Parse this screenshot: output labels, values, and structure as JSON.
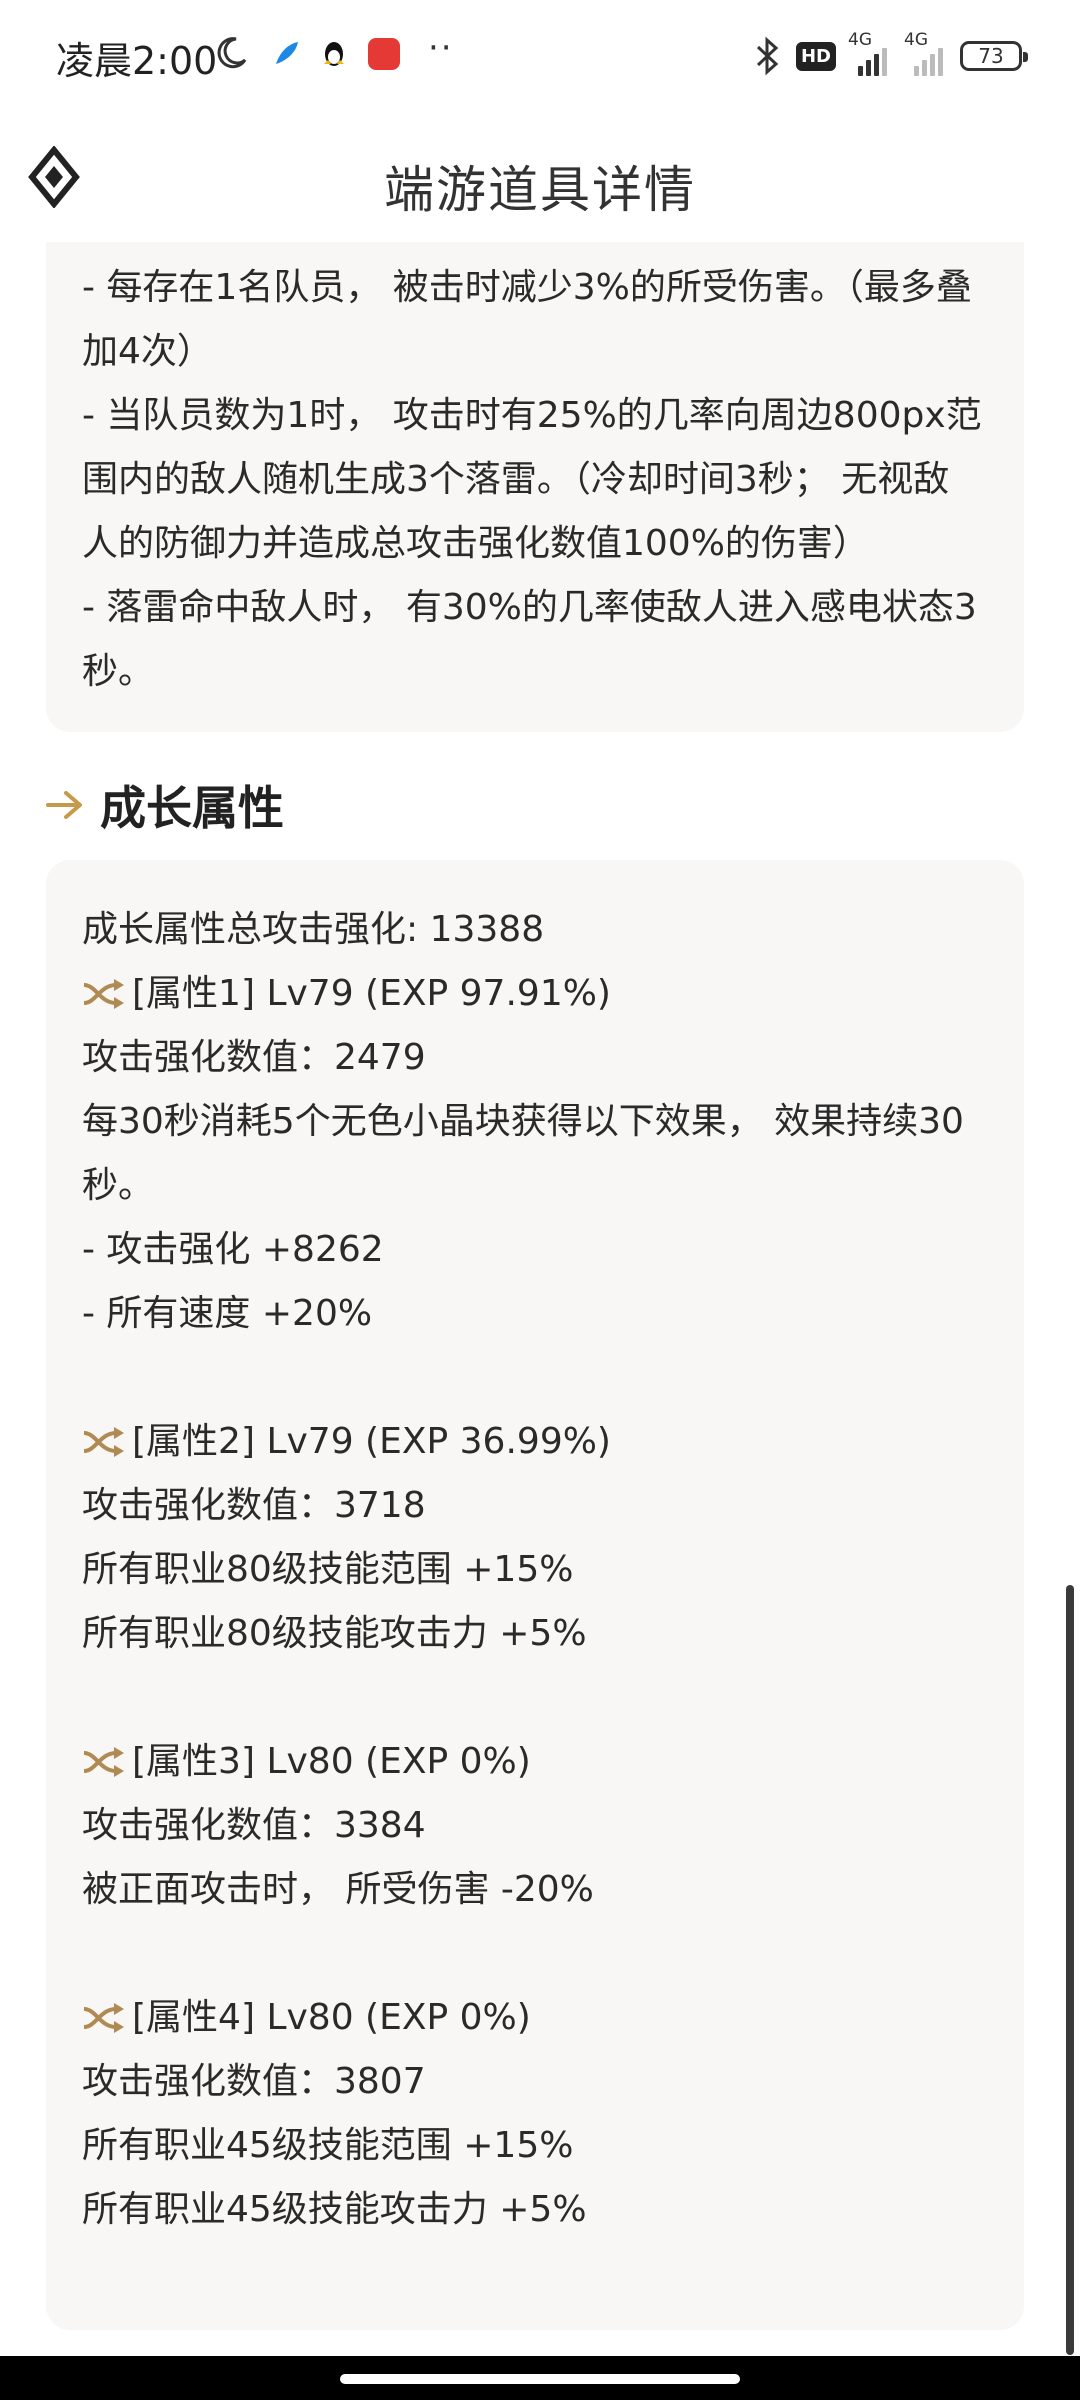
{
  "status_bar": {
    "time": "凌晨2:00",
    "icons": [
      "moon-icon",
      "feather-app-icon",
      "qq-penguin-icon",
      "app-icon-red",
      "more-icon",
      "bluetooth-icon"
    ],
    "hd": "HD",
    "network_1": "4G",
    "network_2": "4G",
    "battery": "73"
  },
  "header": {
    "title": "端游道具详情",
    "logo_icon": "game-logo-icon"
  },
  "description": {
    "lines": [
      "- 每存在1名队员， 被击时减少3%的所受伤害。（最多叠",
      "加4次）",
      "- 当队员数为1时， 攻击时有25%的几率向周边800px范",
      "围内的敌人随机生成3个落雷。（冷却时间3秒； 无视敌",
      "人的防御力并造成总攻击强化数值100%的伤害）",
      "- 落雷命中敌人时， 有30%的几率使敌人进入感电状态3",
      "秒。"
    ]
  },
  "growth": {
    "title": "成长属性",
    "total": "成长属性总攻击强化: 13388",
    "attributes": [
      {
        "head": "[属性1] Lv79 (EXP 97.91%)",
        "value": "攻击强化数值：2479",
        "effects": [
          "每30秒消耗5个无色小晶块获得以下效果， 效果持续30",
          "秒。",
          "- 攻击强化 +8262",
          "- 所有速度 +20%"
        ]
      },
      {
        "head": "[属性2] Lv79 (EXP 36.99%)",
        "value": "攻击强化数值：3718",
        "effects": [
          "所有职业80级技能范围 +15%",
          "所有职业80级技能攻击力 +5%"
        ]
      },
      {
        "head": "[属性3] Lv80 (EXP 0%)",
        "value": "攻击强化数值：3384",
        "effects": [
          "被正面攻击时， 所受伤害 -20%"
        ]
      },
      {
        "head": "[属性4] Lv80 (EXP 0%)",
        "value": "攻击强化数值：3807",
        "effects": [
          "所有职业45级技能范围 +15%",
          "所有职业45级技能攻击力 +5%"
        ]
      }
    ]
  },
  "colors": {
    "accent_gold": "#c79a4a",
    "card_bg": "#f8f7f5",
    "text": "#2a2a2a"
  }
}
